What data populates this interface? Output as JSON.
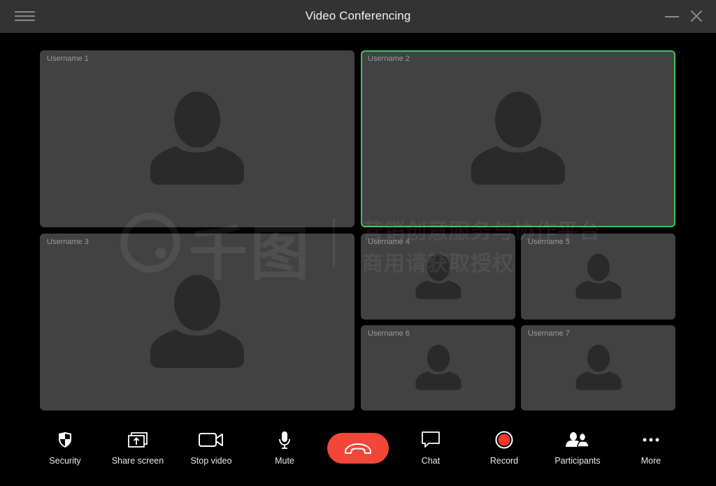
{
  "window": {
    "title": "Video Conferencing",
    "menu_icon": "hamburger-menu-icon",
    "minimize_icon": "minimize-icon",
    "close_icon": "close-icon"
  },
  "tiles": [
    {
      "username": "Username 1",
      "active": false
    },
    {
      "username": "Username 2",
      "active": true
    },
    {
      "username": "Username 3",
      "active": false
    },
    {
      "username": "Username 4",
      "active": false
    },
    {
      "username": "Username 5",
      "active": false
    },
    {
      "username": "Username 6",
      "active": false
    },
    {
      "username": "Username 7",
      "active": false
    }
  ],
  "colors": {
    "active_speaker_border": "#3fc25a",
    "end_call": "#f24638",
    "record": "#f0392d",
    "titlebar": "#333333",
    "tile_bg": "#424242",
    "avatar": "#2a2a2a"
  },
  "watermark": {
    "line1": "营销创意服务与协作平台",
    "line2": "商用请获取授权",
    "logo": "千图"
  },
  "toolbar": {
    "security": {
      "label": "Security",
      "icon": "shield-icon"
    },
    "share_screen": {
      "label": "Share screen",
      "icon": "share-screen-icon"
    },
    "stop_video": {
      "label": "Stop video",
      "icon": "video-camera-icon"
    },
    "mute": {
      "label": "Mute",
      "icon": "microphone-icon"
    },
    "end_call": {
      "icon": "hang-up-icon"
    },
    "chat": {
      "label": "Chat",
      "icon": "chat-bubble-icon"
    },
    "record": {
      "label": "Record",
      "icon": "record-icon"
    },
    "participants": {
      "label": "Participants",
      "icon": "participants-icon"
    },
    "more": {
      "label": "More",
      "icon": "more-dots-icon"
    }
  }
}
